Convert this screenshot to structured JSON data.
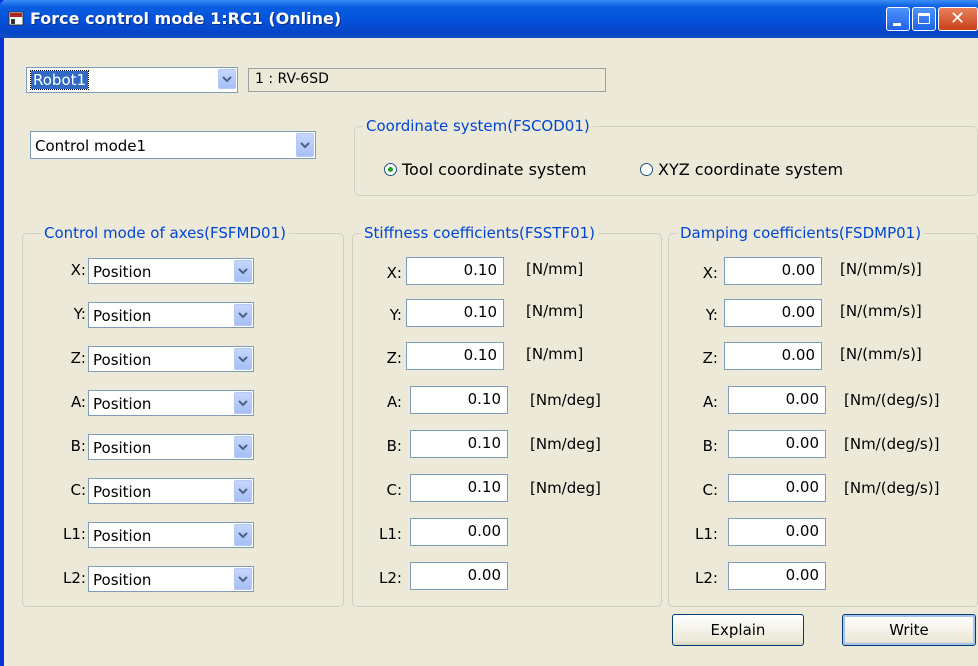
{
  "window": {
    "title": "Force control mode 1:RC1 (Online)",
    "icon": "app-icon"
  },
  "robot": {
    "selected": "Robot1",
    "info": "1 : RV-6SD"
  },
  "control_mode": {
    "selected": "Control mode1"
  },
  "coordinate_system": {
    "legend": "Coordinate system(FSCOD01)",
    "options": [
      {
        "label": "Tool coordinate system",
        "selected": true
      },
      {
        "label": "XYZ coordinate system",
        "selected": false
      }
    ]
  },
  "axes_mode": {
    "legend": "Control mode of axes(FSFMD01)",
    "rows": [
      {
        "axis": "X:",
        "value": "Position"
      },
      {
        "axis": "Y:",
        "value": "Position"
      },
      {
        "axis": "Z:",
        "value": "Position"
      },
      {
        "axis": "A:",
        "value": "Position"
      },
      {
        "axis": "B:",
        "value": "Position"
      },
      {
        "axis": "C:",
        "value": "Position"
      },
      {
        "axis": "L1:",
        "value": "Position"
      },
      {
        "axis": "L2:",
        "value": "Position"
      }
    ]
  },
  "stiffness": {
    "legend": "Stiffness coefficients(FSSTF01)",
    "rows": [
      {
        "axis": "X:",
        "value": "0.10",
        "unit": "[N/mm]"
      },
      {
        "axis": "Y:",
        "value": "0.10",
        "unit": "[N/mm]"
      },
      {
        "axis": "Z:",
        "value": "0.10",
        "unit": "[N/mm]"
      },
      {
        "axis": "A:",
        "value": "0.10",
        "unit": "[Nm/deg]"
      },
      {
        "axis": "B:",
        "value": "0.10",
        "unit": "[Nm/deg]"
      },
      {
        "axis": "C:",
        "value": "0.10",
        "unit": "[Nm/deg]"
      },
      {
        "axis": "L1:",
        "value": "0.00",
        "unit": ""
      },
      {
        "axis": "L2:",
        "value": "0.00",
        "unit": ""
      }
    ]
  },
  "damping": {
    "legend": "Damping coefficients(FSDMP01)",
    "rows": [
      {
        "axis": "X:",
        "value": "0.00",
        "unit": "[N/(mm/s)]"
      },
      {
        "axis": "Y:",
        "value": "0.00",
        "unit": "[N/(mm/s)]"
      },
      {
        "axis": "Z:",
        "value": "0.00",
        "unit": "[N/(mm/s)]"
      },
      {
        "axis": "A:",
        "value": "0.00",
        "unit": "[Nm/(deg/s)]"
      },
      {
        "axis": "B:",
        "value": "0.00",
        "unit": "[Nm/(deg/s)]"
      },
      {
        "axis": "C:",
        "value": "0.00",
        "unit": "[Nm/(deg/s)]"
      },
      {
        "axis": "L1:",
        "value": "0.00",
        "unit": ""
      },
      {
        "axis": "L2:",
        "value": "0.00",
        "unit": ""
      }
    ]
  },
  "buttons": {
    "explain": "Explain",
    "write": "Write"
  },
  "colors": {
    "title_bar": "#0453dc",
    "legend_text": "#0046d5",
    "dialog_bg": "#ece9d8",
    "selection": "#316ac5"
  }
}
